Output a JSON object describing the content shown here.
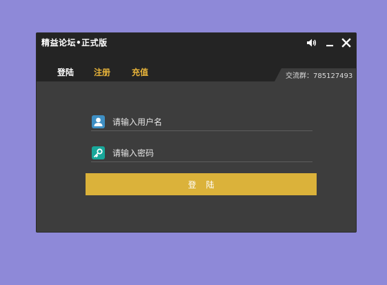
{
  "window": {
    "title": "精益论坛•正式版"
  },
  "controls": {
    "sound_icon": "speaker-icon",
    "minimize_icon": "minimize-icon",
    "close_icon": "close-icon"
  },
  "tabs": [
    {
      "label": "登陆",
      "color": "#ffffff",
      "active": true
    },
    {
      "label": "注册",
      "color": "#e8b43a",
      "active": false
    },
    {
      "label": "充值",
      "color": "#e8b43a",
      "active": false
    }
  ],
  "group": {
    "text": "交流群：785127493"
  },
  "form": {
    "username": {
      "icon": "user-icon",
      "placeholder": "请输入用户名",
      "value": ""
    },
    "password": {
      "icon": "key-icon",
      "placeholder": "请输入密码",
      "value": ""
    },
    "login_button": "登陆"
  },
  "colors": {
    "background": "#8e89d8",
    "window": "#3d3d3d",
    "header": "#242424",
    "accent": "#dbb23a",
    "tab_accent": "#e8b43a",
    "user_icon_bg": "#3e8fc4",
    "key_icon_bg": "#19a79a"
  }
}
